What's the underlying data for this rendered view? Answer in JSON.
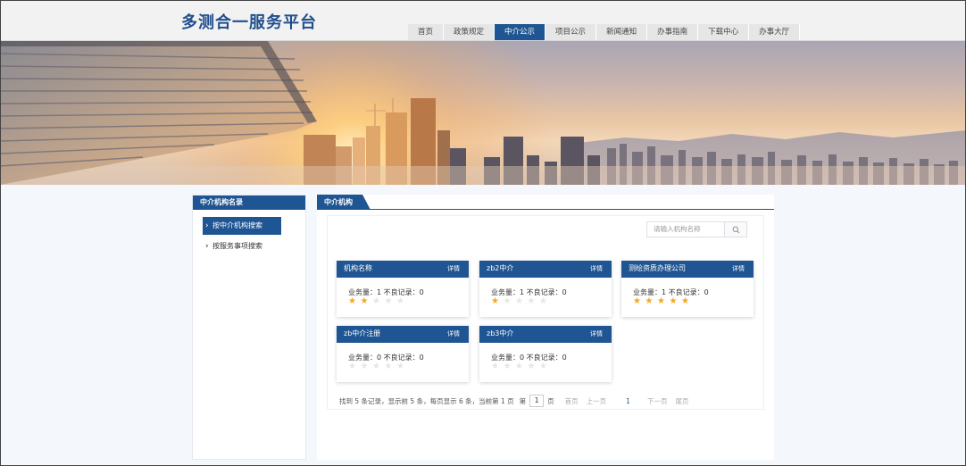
{
  "header": {
    "logo": "多测合一服务平台",
    "nav": [
      {
        "label": "首页"
      },
      {
        "label": "政策规定"
      },
      {
        "label": "中介公示",
        "active": true
      },
      {
        "label": "项目公示"
      },
      {
        "label": "新闻通知"
      },
      {
        "label": "办事指南"
      },
      {
        "label": "下载中心"
      },
      {
        "label": "办事大厅"
      }
    ]
  },
  "sidebar": {
    "title": "中介机构名录",
    "items": [
      {
        "label": "按中介机构搜索",
        "active": true
      },
      {
        "label": "按服务事项搜索",
        "active": false
      }
    ]
  },
  "main": {
    "tab": "中介机构",
    "search": {
      "placeholder": "请输入机构名称",
      "icon": "search-icon"
    },
    "cards": [
      {
        "name": "机构名称",
        "detail": "详情",
        "stats": "业务量：1 不良记录：0",
        "rating": 2
      },
      {
        "name": "zb2中介",
        "detail": "详情",
        "stats": "业务量：1 不良记录：0",
        "rating": 1
      },
      {
        "name": "测绘资质办理公司",
        "detail": "详情",
        "stats": "业务量：1 不良记录：0",
        "rating": 5
      },
      {
        "name": "zb中介注册",
        "detail": "详情",
        "stats": "业务量：0 不良记录：0",
        "rating": 0
      },
      {
        "name": "zb3中介",
        "detail": "详情",
        "stats": "业务量：0 不良记录：0",
        "rating": 0
      }
    ],
    "pager": {
      "summary": "找到 5 条记录，显示前 5 条，每页显示 6 条，当前第 1 页",
      "page_prefix": "第",
      "page_value": "1",
      "page_suffix": "页",
      "first": "首页",
      "prev": "上一页",
      "current": "1",
      "next": "下一页",
      "last": "尾页"
    }
  },
  "colors": {
    "primary": "#1f5592",
    "star_on": "#f6a623",
    "star_off": "#e6e6e6"
  }
}
